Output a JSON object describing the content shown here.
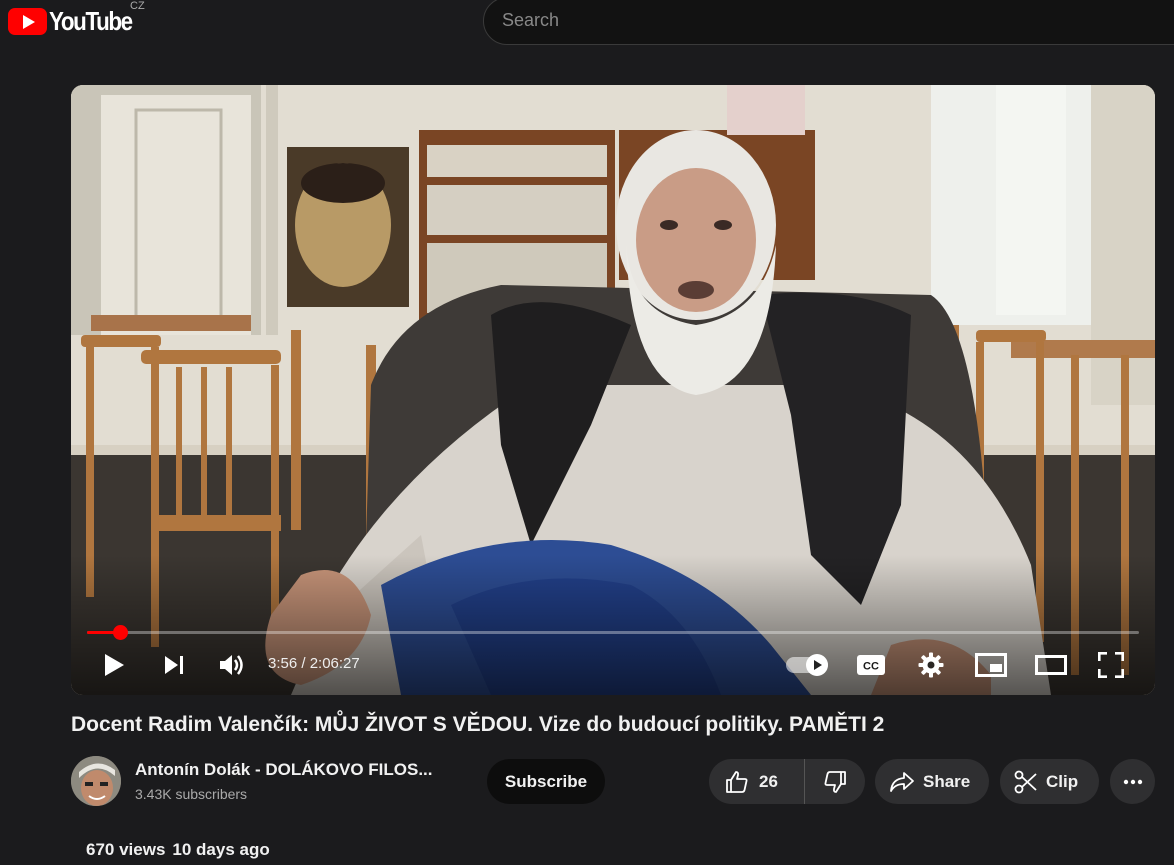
{
  "header": {
    "logo_text": "YouTube",
    "region": "CZ",
    "search_placeholder": "Search"
  },
  "player": {
    "current_time": "3:56",
    "duration": "2:06:27",
    "time_display": "3:56 / 2:06:27",
    "progress_fraction": 0.031,
    "autoplay_on": true,
    "icons": [
      "play-icon",
      "next-icon",
      "volume-icon",
      "autoplay-toggle",
      "subtitles-icon",
      "settings-icon",
      "miniplayer-icon",
      "theater-icon",
      "fullscreen-icon"
    ],
    "accent_color": "#ff0000"
  },
  "video": {
    "title": "Docent Radim Valenčík: MŮJ ŽIVOT S VĚDOU. Vize do budoucí politiky. PAMĚTI 2",
    "views": "670 views",
    "uploaded": "10 days ago"
  },
  "channel": {
    "name": "Antonín Dolák - DOLÁKOVO FILOS...",
    "subscribers": "3.43K subscribers",
    "subscribe_label": "Subscribe"
  },
  "actions": {
    "like_count": "26",
    "share_label": "Share",
    "clip_label": "Clip"
  }
}
